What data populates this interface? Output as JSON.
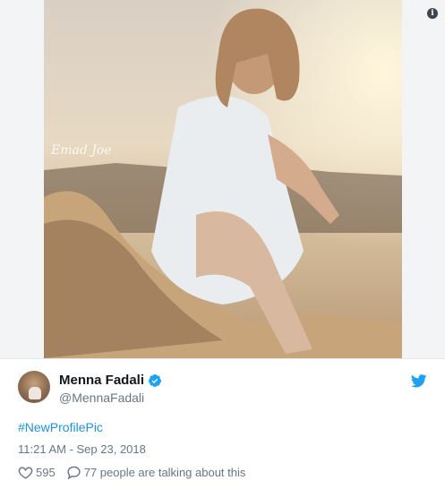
{
  "tweet": {
    "author": {
      "display_name": "Menna Fadali",
      "handle": "@MennaFadali",
      "verified": true
    },
    "hashtag": "#NewProfilePic",
    "timestamp": "11:21 AM - Sep 23, 2018",
    "likes": "595",
    "conversation": "77 people are talking about this"
  },
  "photo": {
    "watermark": "Emad Joe"
  },
  "icons": {
    "info": "info-icon",
    "verified": "verified-badge-icon",
    "twitter": "twitter-bird-icon",
    "like": "heart-icon",
    "reply": "speech-bubble-icon"
  },
  "colors": {
    "link": "#1b95e0",
    "muted": "#657786",
    "text": "#14171a",
    "twitter_blue": "#1da1f2"
  }
}
